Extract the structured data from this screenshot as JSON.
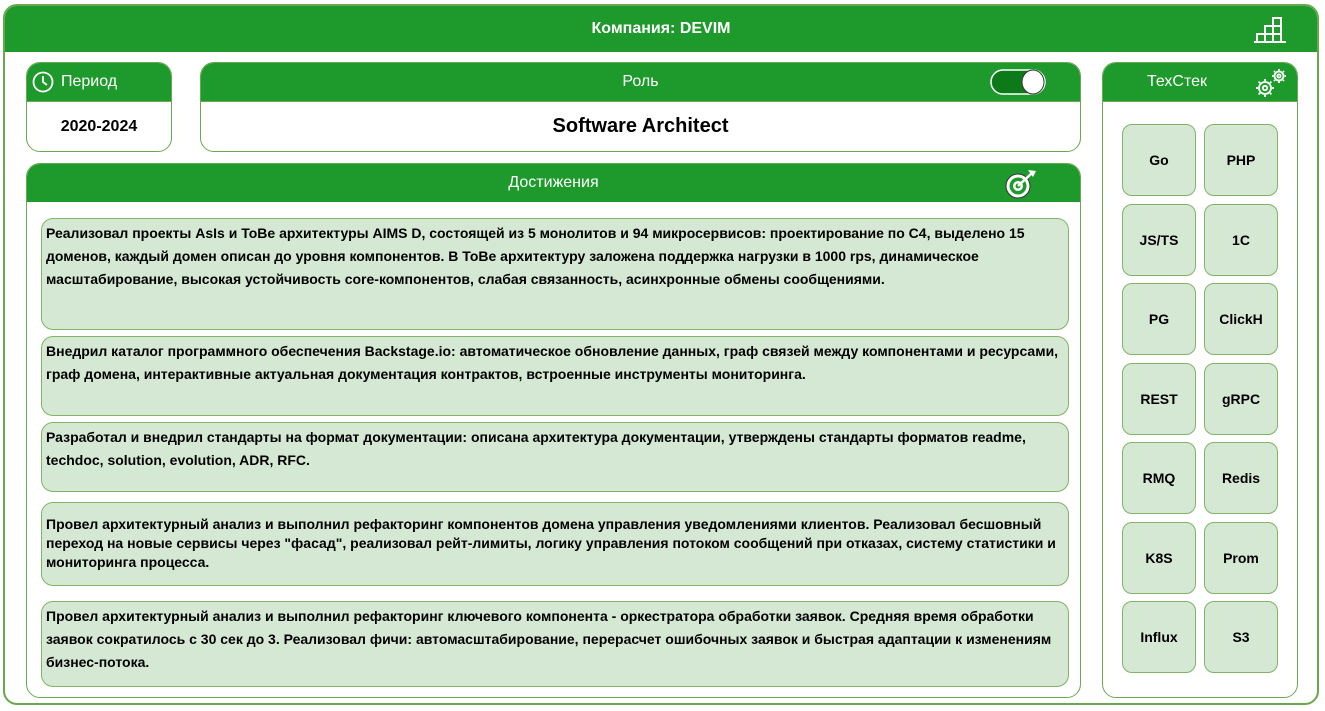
{
  "header": {
    "title": "Компания: DEVIM"
  },
  "period": {
    "label": "Период",
    "value": "2020-2024"
  },
  "role": {
    "label": "Роль",
    "value": "Software Architect"
  },
  "achievements": {
    "label": "Достижения",
    "items": [
      "Реализовал проекты AsIs и ToBe архитектуры AIMS D, состоящей из 5 монолитов и 94 микросервисов: проектирование по C4, выделено 15 доменов, каждый домен описан до уровня компонентов. В ToBe архитектуру заложена поддержка нагрузки в 1000 rps, динамическое масштабирование, высокая устойчивость core-компонентов, слабая связанность, асинхронные обмены сообщениями.",
      "Внедрил каталог программного обеспечения Backstage.io: автоматическое обновление данных, граф связей между компонентами и ресурсами, граф домена,  интерактивные актуальная документация контрактов, встроенные инструменты мониторинга.",
      "Разработал и внедрил стандарты на формат документации: описана архитектура документации, утверждены стандарты форматов readme, techdoc, solution, evolution, ADR, RFC.",
      "Провел архитектурный анализ и выполнил рефакторинг компонентов домена управления уведомлениями клиентов. Реализовал бесшовный переход на новые сервисы через \"фасад\", реализовал рейт-лимиты, логику управления потоком сообщений при отказах, систему статистики и мониторинга процесса.",
      "Провел архитектурный анализ и выполнил рефакторинг ключевого компонента - оркестратора обработки заявок. Средняя время обработки заявок сократилось с 30 сек до 3. Реализовал фичи: автомасштабирование, перерасчет ошибочных заявок и быстрая адаптации к изменениям бизнес-потока."
    ]
  },
  "techstack": {
    "label": "ТехСтек",
    "items": [
      "Go",
      "PHP",
      "JS/TS",
      "1C",
      "PG",
      "ClickH",
      "REST",
      "gRPC",
      "RMQ",
      "Redis",
      "K8S",
      "Prom",
      "Influx",
      "S3"
    ]
  },
  "icons": {
    "header": "building-icon",
    "period": "clock-icon",
    "role": "toggle-icon",
    "achievements": "target-icon",
    "techstack": "gear-icon"
  },
  "colors": {
    "header_green": "#1e9a2c",
    "border_green": "#6aa84f",
    "card_fill": "#d5e8d4"
  }
}
